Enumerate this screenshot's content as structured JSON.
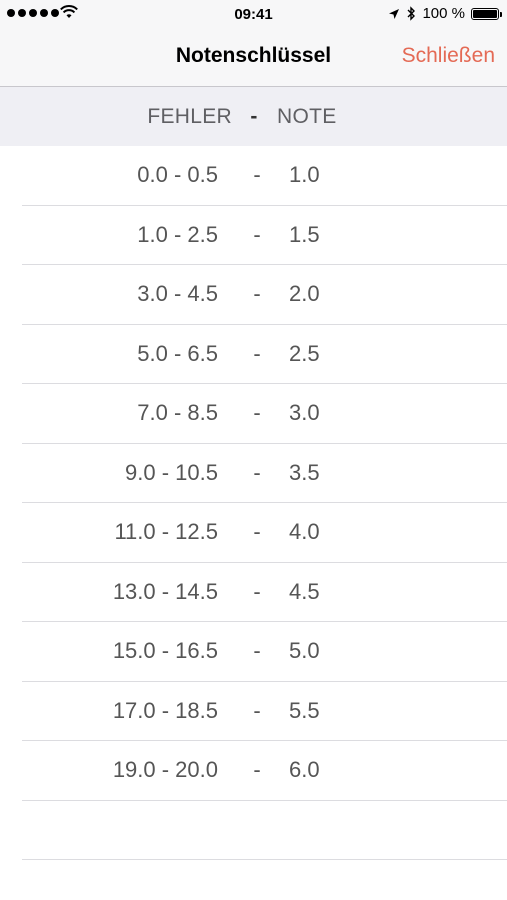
{
  "status_bar": {
    "time": "09:41",
    "battery": "100 %",
    "battery_level": 1.0,
    "icons": [
      "signal-dots-icon",
      "wifi-icon",
      "location-arrow-icon",
      "bluetooth-icon",
      "battery-icon"
    ]
  },
  "nav": {
    "title": "Notenschlüssel",
    "close_label": "Schließen",
    "accent_color": "#e46a55"
  },
  "header": {
    "errors_label": "FEHLER",
    "separator": "-",
    "grade_label": "NOTE"
  },
  "rows": [
    {
      "range": "0.0 - 0.5",
      "sep": "-",
      "grade": "1.0"
    },
    {
      "range": "1.0 - 2.5",
      "sep": "-",
      "grade": "1.5"
    },
    {
      "range": "3.0 - 4.5",
      "sep": "-",
      "grade": "2.0"
    },
    {
      "range": "5.0 - 6.5",
      "sep": "-",
      "grade": "2.5"
    },
    {
      "range": "7.0 - 8.5",
      "sep": "-",
      "grade": "3.0"
    },
    {
      "range": "9.0 - 10.5",
      "sep": "-",
      "grade": "3.5"
    },
    {
      "range": "11.0 - 12.5",
      "sep": "-",
      "grade": "4.0"
    },
    {
      "range": "13.0 - 14.5",
      "sep": "-",
      "grade": "4.5"
    },
    {
      "range": "15.0 - 16.5",
      "sep": "-",
      "grade": "5.0"
    },
    {
      "range": "17.0 - 18.5",
      "sep": "-",
      "grade": "5.5"
    },
    {
      "range": "19.0 - 20.0",
      "sep": "-",
      "grade": "6.0"
    },
    {
      "range": "",
      "sep": "",
      "grade": ""
    }
  ]
}
